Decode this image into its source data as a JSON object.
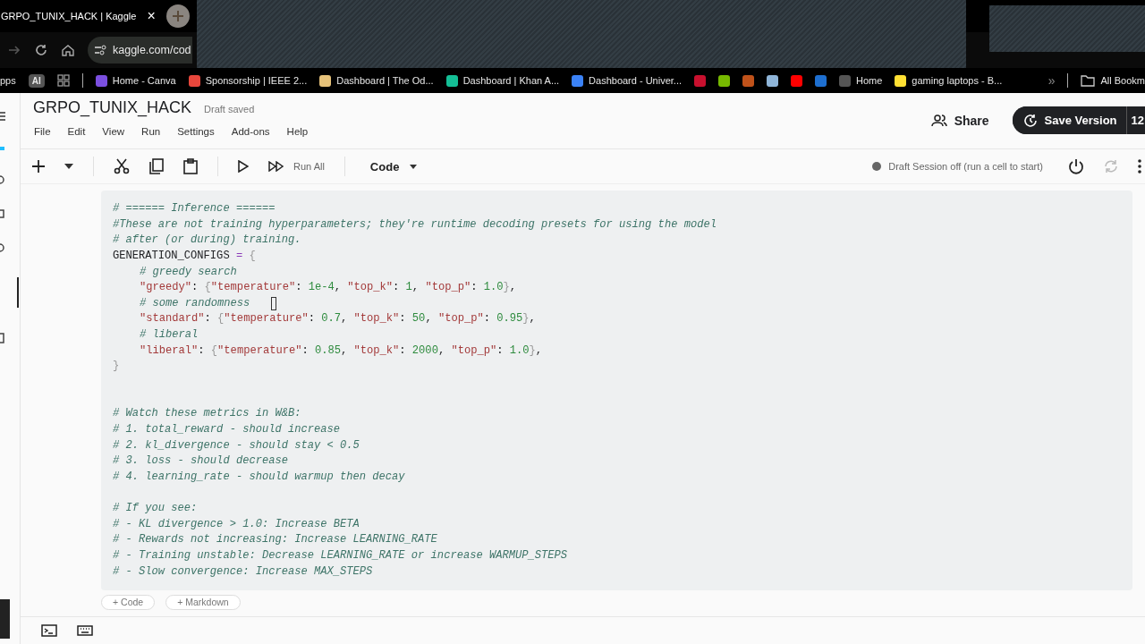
{
  "browser": {
    "tab_title": "GRPO_TUNIX_HACK | Kaggle",
    "tab_close": "×",
    "url": "kaggle.com/cod",
    "bookmarks": [
      {
        "kind": "text",
        "label": "pps"
      },
      {
        "kind": "badge",
        "label": "AI"
      },
      {
        "kind": "grid"
      },
      {
        "kind": "separator"
      },
      {
        "kind": "site",
        "label": "Home - Canva",
        "color": "#7b4fe0"
      },
      {
        "kind": "site",
        "label": "Sponsorship | IEEE 2...",
        "color": "#e8473c"
      },
      {
        "kind": "site",
        "label": "Dashboard | The Od...",
        "color": "#e6c27a"
      },
      {
        "kind": "site",
        "label": "Dashboard | Khan A...",
        "color": "#14bf96"
      },
      {
        "kind": "site",
        "label": "Dashboard - Univer...",
        "color": "#3b82f6"
      },
      {
        "kind": "site",
        "color": "#c8102e"
      },
      {
        "kind": "site",
        "color": "#76b900"
      },
      {
        "kind": "site",
        "color": "#c0521a"
      },
      {
        "kind": "site",
        "color": "#8fb5d8"
      },
      {
        "kind": "site",
        "color": "#ff0000"
      },
      {
        "kind": "site",
        "color": "#1e6fd0"
      },
      {
        "kind": "site",
        "label": "Home",
        "color": "#555555"
      },
      {
        "kind": "site",
        "label": "gaming laptops - B...",
        "color": "#ffe033"
      },
      {
        "kind": "more",
        "label": "»"
      },
      {
        "kind": "separator"
      },
      {
        "kind": "folder",
        "label": "All Bookm"
      }
    ]
  },
  "notebook": {
    "title": "GRPO_TUNIX_HACK",
    "status": "Draft saved",
    "menu": [
      "File",
      "Edit",
      "View",
      "Run",
      "Settings",
      "Add-ons",
      "Help"
    ],
    "share_label": "Share",
    "save_label": "Save Version",
    "save_count": "12",
    "toolbar": {
      "run_all_label": "Run All",
      "cell_type": "Code",
      "session_status": "Draft Session off (run a cell to start)"
    },
    "cell": {
      "lines": [
        {
          "kind": "code",
          "indent": false,
          "tokens": [
            {
              "kind": "comment",
              "text": "# ====== Inference ======"
            }
          ]
        },
        {
          "kind": "code",
          "indent": false,
          "tokens": [
            {
              "kind": "comment",
              "text": "#These are not training hyperparameters; they're runtime decoding presets for using the model"
            }
          ]
        },
        {
          "kind": "code",
          "indent": false,
          "tokens": [
            {
              "kind": "comment",
              "text": "# after (or during) training."
            }
          ]
        },
        {
          "kind": "code",
          "indent": false,
          "tokens": [
            {
              "kind": "plain",
              "text": "GENERATION_CONFIGS "
            },
            {
              "kind": "operator",
              "text": "="
            },
            {
              "kind": "brace",
              "text": " {"
            }
          ]
        },
        {
          "kind": "code",
          "indent": true,
          "tokens": [
            {
              "kind": "comment",
              "text": "# greedy search"
            }
          ]
        },
        {
          "kind": "code",
          "indent": true,
          "tokens": [
            {
              "kind": "string",
              "text": "\"greedy\""
            },
            {
              "kind": "plain",
              "text": ": "
            },
            {
              "kind": "brace",
              "text": "{"
            },
            {
              "kind": "string",
              "text": "\"temperature\""
            },
            {
              "kind": "plain",
              "text": ": "
            },
            {
              "kind": "number",
              "text": "1e-4"
            },
            {
              "kind": "plain",
              "text": ", "
            },
            {
              "kind": "string",
              "text": "\"top_k\""
            },
            {
              "kind": "plain",
              "text": ": "
            },
            {
              "kind": "number",
              "text": "1"
            },
            {
              "kind": "plain",
              "text": ", "
            },
            {
              "kind": "string",
              "text": "\"top_p\""
            },
            {
              "kind": "plain",
              "text": ": "
            },
            {
              "kind": "number",
              "text": "1.0"
            },
            {
              "kind": "brace",
              "text": "}"
            },
            {
              "kind": "plain",
              "text": ","
            }
          ]
        },
        {
          "kind": "code",
          "indent": true,
          "cursor": true,
          "tokens": [
            {
              "kind": "comment",
              "text": "# some randomness"
            }
          ]
        },
        {
          "kind": "code",
          "indent": true,
          "tokens": [
            {
              "kind": "string",
              "text": "\"standard\""
            },
            {
              "kind": "plain",
              "text": ": "
            },
            {
              "kind": "brace",
              "text": "{"
            },
            {
              "kind": "string",
              "text": "\"temperature\""
            },
            {
              "kind": "plain",
              "text": ": "
            },
            {
              "kind": "number",
              "text": "0.7"
            },
            {
              "kind": "plain",
              "text": ", "
            },
            {
              "kind": "string",
              "text": "\"top_k\""
            },
            {
              "kind": "plain",
              "text": ": "
            },
            {
              "kind": "number",
              "text": "50"
            },
            {
              "kind": "plain",
              "text": ", "
            },
            {
              "kind": "string",
              "text": "\"top_p\""
            },
            {
              "kind": "plain",
              "text": ": "
            },
            {
              "kind": "number",
              "text": "0.95"
            },
            {
              "kind": "brace",
              "text": "}"
            },
            {
              "kind": "plain",
              "text": ","
            }
          ]
        },
        {
          "kind": "code",
          "indent": true,
          "tokens": [
            {
              "kind": "comment",
              "text": "# liberal"
            }
          ]
        },
        {
          "kind": "code",
          "indent": true,
          "tokens": [
            {
              "kind": "string",
              "text": "\"liberal\""
            },
            {
              "kind": "plain",
              "text": ": "
            },
            {
              "kind": "brace",
              "text": "{"
            },
            {
              "kind": "string",
              "text": "\"temperature\""
            },
            {
              "kind": "plain",
              "text": ": "
            },
            {
              "kind": "number",
              "text": "0.85"
            },
            {
              "kind": "plain",
              "text": ", "
            },
            {
              "kind": "string",
              "text": "\"top_k\""
            },
            {
              "kind": "plain",
              "text": ": "
            },
            {
              "kind": "number",
              "text": "2000"
            },
            {
              "kind": "plain",
              "text": ", "
            },
            {
              "kind": "string",
              "text": "\"top_p\""
            },
            {
              "kind": "plain",
              "text": ": "
            },
            {
              "kind": "number",
              "text": "1.0"
            },
            {
              "kind": "brace",
              "text": "}"
            },
            {
              "kind": "plain",
              "text": ","
            }
          ]
        },
        {
          "kind": "code",
          "indent": false,
          "tokens": [
            {
              "kind": "brace",
              "text": "}"
            }
          ]
        },
        {
          "kind": "blank"
        },
        {
          "kind": "blank"
        },
        {
          "kind": "code",
          "indent": false,
          "tokens": [
            {
              "kind": "comment",
              "text": "# Watch these metrics in W&B:"
            }
          ]
        },
        {
          "kind": "code",
          "indent": false,
          "tokens": [
            {
              "kind": "comment",
              "text": "# 1. total_reward - should increase"
            }
          ]
        },
        {
          "kind": "code",
          "indent": false,
          "tokens": [
            {
              "kind": "comment",
              "text": "# 2. kl_divergence - should stay < 0.5"
            }
          ]
        },
        {
          "kind": "code",
          "indent": false,
          "tokens": [
            {
              "kind": "comment",
              "text": "# 3. loss - should decrease"
            }
          ]
        },
        {
          "kind": "code",
          "indent": false,
          "tokens": [
            {
              "kind": "comment",
              "text": "# 4. learning_rate - should warmup then decay"
            }
          ]
        },
        {
          "kind": "blank"
        },
        {
          "kind": "code",
          "indent": false,
          "tokens": [
            {
              "kind": "comment",
              "text": "# If you see:"
            }
          ]
        },
        {
          "kind": "code",
          "indent": false,
          "tokens": [
            {
              "kind": "comment",
              "text": "# - KL divergence > 1.0: Increase BETA"
            }
          ]
        },
        {
          "kind": "code",
          "indent": false,
          "tokens": [
            {
              "kind": "comment",
              "text": "# - Rewards not increasing: Increase LEARNING_RATE"
            }
          ]
        },
        {
          "kind": "code",
          "indent": false,
          "tokens": [
            {
              "kind": "comment",
              "text": "# - Training unstable: Decrease LEARNING_RATE or increase WARMUP_STEPS"
            }
          ]
        },
        {
          "kind": "code",
          "indent": false,
          "tokens": [
            {
              "kind": "comment",
              "text": "# - Slow convergence: Increase MAX_STEPS"
            }
          ]
        }
      ]
    },
    "add_buttons": [
      "+ Code",
      "+ Markdown"
    ]
  }
}
